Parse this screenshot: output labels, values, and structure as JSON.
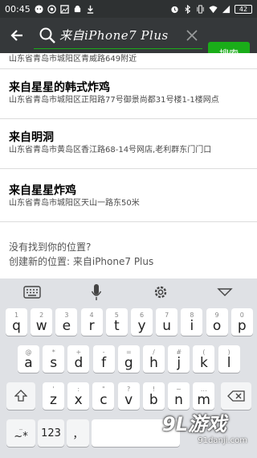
{
  "status": {
    "time": "00:45",
    "battery": "42"
  },
  "search": {
    "query": "来自iPhone7  Plus",
    "button_label": "搜索"
  },
  "results": [
    {
      "title": "",
      "address": "山东省青岛市城阳区青威路649附近"
    },
    {
      "title": "来自星星的韩式炸鸡",
      "address": "山东省青岛市城阳区正阳路77号御景尚都31号楼1-1楼网点"
    },
    {
      "title": "来自明洞",
      "address": "山东省青岛市黄岛区香江路68-14号网店,老利群东门门口"
    },
    {
      "title": "来自星星炸鸡",
      "address": "山东省青岛市城阳区天山一路东50米"
    }
  ],
  "create": {
    "line1": "没有找到你的位置?",
    "line2": "创建新的位置: 来自iPhone7  Plus"
  },
  "keyboard": {
    "row1": [
      {
        "k": "q",
        "s": "1"
      },
      {
        "k": "w",
        "s": "2"
      },
      {
        "k": "e",
        "s": "3"
      },
      {
        "k": "r",
        "s": "4"
      },
      {
        "k": "t",
        "s": "5"
      },
      {
        "k": "y",
        "s": "6"
      },
      {
        "k": "u",
        "s": "7"
      },
      {
        "k": "i",
        "s": "8"
      },
      {
        "k": "o",
        "s": "9"
      },
      {
        "k": "p",
        "s": "0"
      }
    ],
    "row2": [
      {
        "k": "a",
        "s": "@"
      },
      {
        "k": "s",
        "s": "*"
      },
      {
        "k": "d",
        "s": "+"
      },
      {
        "k": "f",
        "s": "-"
      },
      {
        "k": "g",
        "s": "="
      },
      {
        "k": "h",
        "s": "/"
      },
      {
        "k": "j",
        "s": "#"
      },
      {
        "k": "k",
        "s": "("
      },
      {
        "k": "l",
        "s": ")"
      }
    ],
    "row3": [
      {
        "k": "z",
        "s": "'"
      },
      {
        "k": "x",
        "s": ":"
      },
      {
        "k": "c",
        "s": "\""
      },
      {
        "k": "v",
        "s": "?"
      },
      {
        "k": "b",
        "s": "!"
      },
      {
        "k": "n",
        "s": "~"
      },
      {
        "k": "m",
        "s": "…"
      }
    ],
    "sym_label": "~*",
    "sym_sub": "_",
    "num_label": "123",
    "comma_label": "，"
  },
  "watermark": {
    "logo": "9L游戏",
    "url": "91danji.com"
  },
  "colors": {
    "accent": "#1aad19",
    "topbar": "#35383a",
    "keyboard_bg": "#dfe1e5"
  }
}
